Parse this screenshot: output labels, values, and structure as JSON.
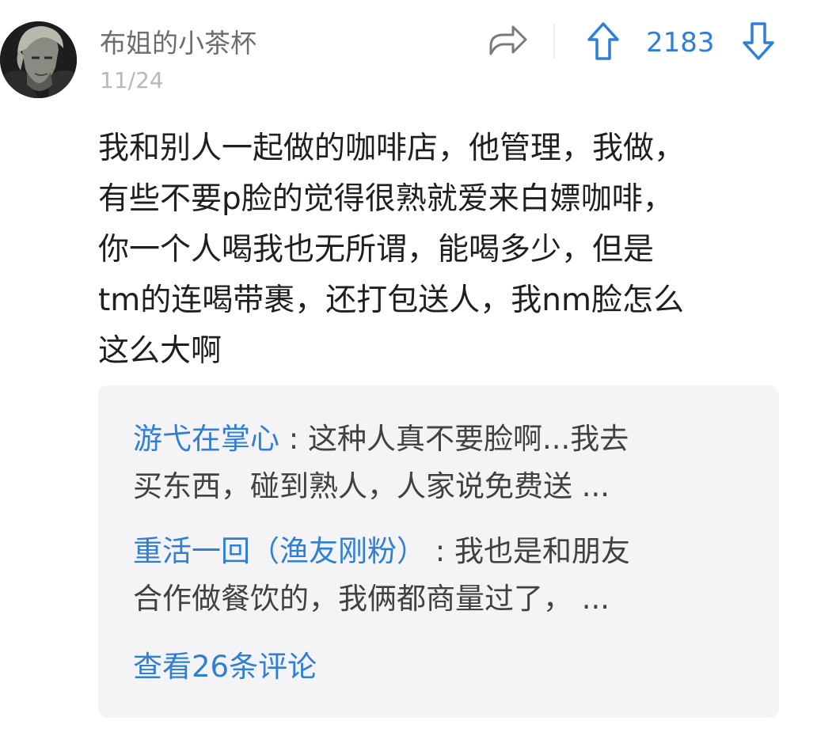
{
  "post": {
    "username": "布姐的小茶杯",
    "date": "11/24",
    "avatar": "avatar",
    "vote_count": "2183",
    "icons": {
      "share": "share-icon",
      "upvote": "upvote-arrow-icon",
      "downvote": "downvote-arrow-icon"
    },
    "text": "我和别人一起做的咖啡店，他管理，我做，\n有些不要p脸的觉得很熟就爱来白嫖咖啡，\n你一个人喝我也无所谓，能喝多少，但是\ntm的连喝带裹，还打包送人，我nm脸怎么\n这么大啊"
  },
  "comments": [
    {
      "author": "游弋在掌心",
      "separator": " : ",
      "text": "这种人真不要脸啊...我去\n买东西，碰到熟人，人家说免费送 ..."
    },
    {
      "author": "重活一回（渔友刚粉）",
      "separator": " : ",
      "text": "我也是和朋友\n合作做餐饮的，我俩都商量过了， ..."
    }
  ],
  "view_more_label": "查看26条评论",
  "colors": {
    "accent": "#2f7fd6",
    "comment_bg": "#f4f4f6",
    "body_text": "#1f1f1f",
    "meta_text": "#b8b8b8"
  }
}
